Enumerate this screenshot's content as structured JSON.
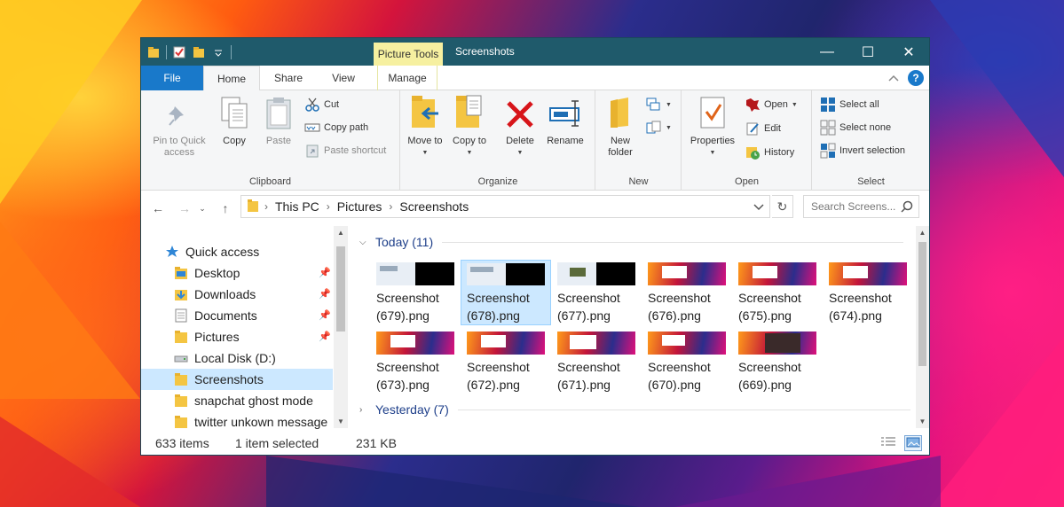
{
  "window": {
    "title": "Screenshots",
    "context_tab": "Picture Tools",
    "controls": {
      "minimize": "—",
      "maximize": "☐",
      "close": "✕"
    }
  },
  "ribbon": {
    "tabs": [
      {
        "label": "File"
      },
      {
        "label": "Home"
      },
      {
        "label": "Share"
      },
      {
        "label": "View"
      },
      {
        "label": "Manage"
      }
    ],
    "clipboard": {
      "label": "Clipboard",
      "pin": "Pin to Quick access",
      "copy": "Copy",
      "paste": "Paste",
      "cut": "Cut",
      "copy_path": "Copy path",
      "paste_shortcut": "Paste shortcut"
    },
    "organize": {
      "label": "Organize",
      "move_to": "Move to",
      "copy_to": "Copy to",
      "delete": "Delete",
      "rename": "Rename"
    },
    "new": {
      "label": "New",
      "new_folder": "New folder"
    },
    "open": {
      "label": "Open",
      "properties": "Properties",
      "open": "Open",
      "edit": "Edit",
      "history": "History"
    },
    "select": {
      "label": "Select",
      "select_all": "Select all",
      "select_none": "Select none",
      "invert": "Invert selection"
    }
  },
  "address": {
    "crumbs": [
      "This PC",
      "Pictures",
      "Screenshots"
    ],
    "search_placeholder": "Search Screens..."
  },
  "nav": {
    "items": [
      {
        "label": "Quick access",
        "icon": "star-icon"
      },
      {
        "label": "Desktop",
        "icon": "folder-icon",
        "pinned": true
      },
      {
        "label": "Downloads",
        "icon": "download-icon",
        "pinned": true
      },
      {
        "label": "Documents",
        "icon": "document-icon",
        "pinned": true
      },
      {
        "label": "Pictures",
        "icon": "folder-icon",
        "pinned": true
      },
      {
        "label": "Local Disk (D:)",
        "icon": "drive-icon"
      },
      {
        "label": "Screenshots",
        "icon": "folder-icon",
        "selected": true
      },
      {
        "label": "snapchat ghost mode",
        "icon": "folder-icon"
      },
      {
        "label": "twitter unkown message",
        "icon": "folder-icon"
      }
    ]
  },
  "content": {
    "groups": [
      {
        "label": "Today (11)",
        "expanded": true
      },
      {
        "label": "Yesterday (7)",
        "expanded": false
      }
    ],
    "files": [
      {
        "line1": "Screenshot",
        "line2": "(679).png"
      },
      {
        "line1": "Screenshot",
        "line2": "(678).png",
        "selected": true
      },
      {
        "line1": "Screenshot",
        "line2": "(677).png"
      },
      {
        "line1": "Screenshot",
        "line2": "(676).png"
      },
      {
        "line1": "Screenshot",
        "line2": "(675).png"
      },
      {
        "line1": "Screenshot",
        "line2": "(674).png"
      },
      {
        "line1": "Screenshot",
        "line2": "(673).png"
      },
      {
        "line1": "Screenshot",
        "line2": "(672).png"
      },
      {
        "line1": "Screenshot",
        "line2": "(671).png"
      },
      {
        "line1": "Screenshot",
        "line2": "(670).png"
      },
      {
        "line1": "Screenshot",
        "line2": "(669).png"
      }
    ]
  },
  "status": {
    "items": "633 items",
    "selected": "1 item selected",
    "size": "231 KB"
  },
  "colors": {
    "titlebar": "#1f5a6b",
    "file_tab": "#1979ca",
    "context_tab": "#f6f0a0",
    "selection": "#cce8ff",
    "group_header": "#1e3f8a"
  }
}
